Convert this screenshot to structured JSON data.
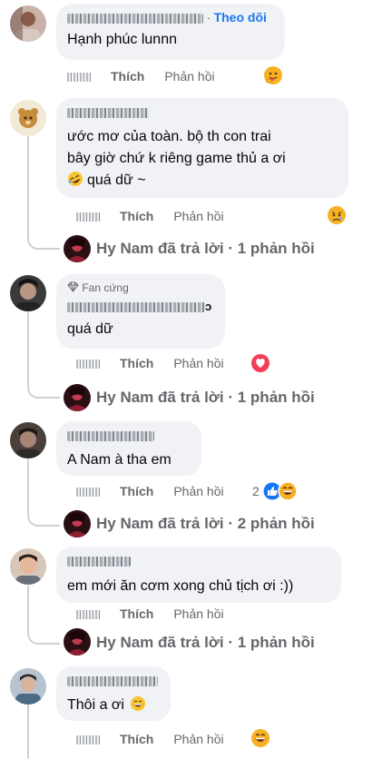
{
  "comments": [
    {
      "text": "Hạnh phúc lunnn",
      "follow": "Theo dõi",
      "like": "Thích",
      "reply": "Phản hồi"
    },
    {
      "text_lines": [
        "ước mơ của toàn. bộ th con trai",
        "bây giờ chứ k riêng game thủ a ơi",
        "quá dữ ~"
      ],
      "like": "Thích",
      "reply": "Phản hồi",
      "replies": {
        "name": "Hy Nam",
        "verb": "đã trả lời",
        "sep": "·",
        "count": "1 phản hồi"
      }
    },
    {
      "badge": "Fan cứng",
      "name_suffix": "ɔ",
      "text": "quá dữ",
      "like": "Thích",
      "reply": "Phản hồi",
      "replies": {
        "name": "Hy Nam",
        "verb": "đã trả lời",
        "sep": "·",
        "count": "1 phản hồi"
      }
    },
    {
      "text": "A Nam à tha em",
      "like": "Thích",
      "reply": "Phản hồi",
      "reaction_count": "2",
      "replies": {
        "name": "Hy Nam",
        "verb": "đã trả lời",
        "sep": "·",
        "count": "2 phản hồi"
      }
    },
    {
      "text": "em mới ăn cơm xong chủ tịch ơi :))",
      "like": "Thích",
      "reply": "Phản hồi",
      "replies": {
        "name": "Hy Nam",
        "verb": "đã trả lời",
        "sep": "·",
        "count": "1 phản hồi"
      }
    },
    {
      "text": "Thôi a ơi",
      "like": "Thích",
      "reply": "Phản hồi"
    }
  ],
  "colors": {
    "bubble": "#f0f2f5",
    "link": "#1877f2",
    "meta": "#65676b",
    "text": "#050505"
  }
}
